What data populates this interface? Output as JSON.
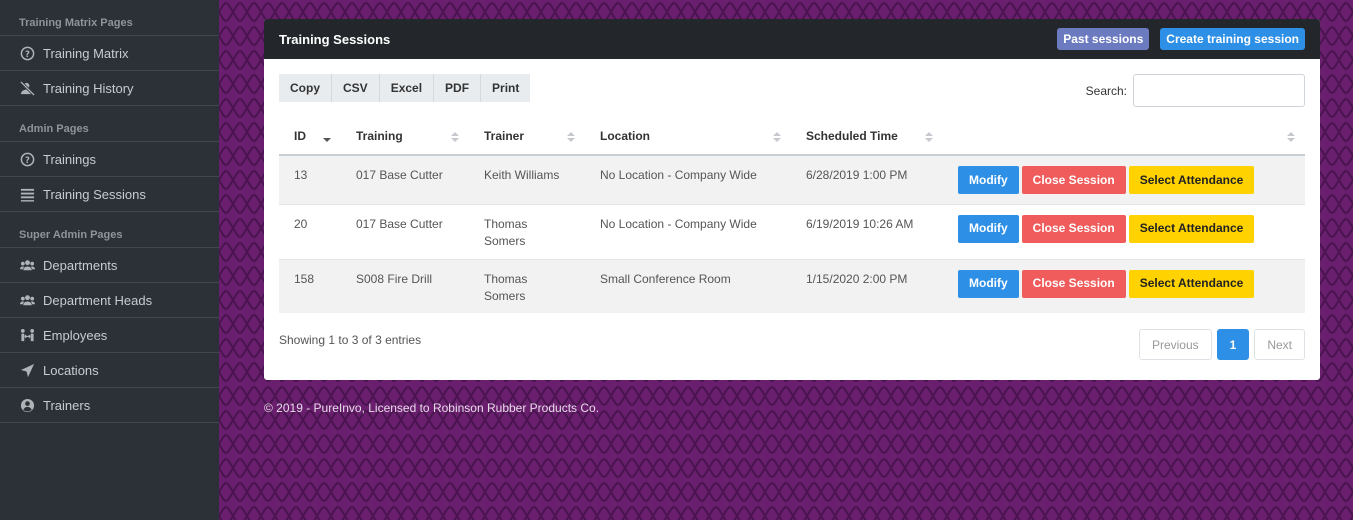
{
  "sidebar": {
    "sections": [
      {
        "title": "Training Matrix Pages",
        "items": [
          {
            "label": "Training Matrix",
            "icon": "question-circle-icon"
          },
          {
            "label": "Training History",
            "icon": "user-slash-icon"
          }
        ]
      },
      {
        "title": "Admin Pages",
        "items": [
          {
            "label": "Trainings",
            "icon": "question-circle-icon"
          },
          {
            "label": "Training Sessions",
            "icon": "list-icon"
          }
        ]
      },
      {
        "title": "Super Admin Pages",
        "items": [
          {
            "label": "Departments",
            "icon": "users-icon"
          },
          {
            "label": "Department Heads",
            "icon": "users-icon"
          },
          {
            "label": "Employees",
            "icon": "people-arrows-icon"
          },
          {
            "label": "Locations",
            "icon": "location-arrow-icon"
          },
          {
            "label": "Trainers",
            "icon": "user-circle-icon"
          }
        ]
      }
    ]
  },
  "card": {
    "title": "Training Sessions",
    "past_sessions_label": "Past sessions",
    "create_session_label": "Create training session"
  },
  "toolbar": {
    "copy": "Copy",
    "csv": "CSV",
    "excel": "Excel",
    "pdf": "PDF",
    "print": "Print"
  },
  "search": {
    "label": "Search:",
    "value": ""
  },
  "table": {
    "headers": [
      "ID",
      "Training",
      "Trainer",
      "Location",
      "Scheduled Time",
      ""
    ],
    "rows": [
      {
        "id": "13",
        "training": "017 Base Cutter",
        "trainer": "Keith Williams",
        "location": "No Location - Company Wide",
        "time": "6/28/2019 1:00 PM"
      },
      {
        "id": "20",
        "training": "017 Base Cutter",
        "trainer": "Thomas Somers",
        "location": "No Location - Company Wide",
        "time": "6/19/2019 10:26 AM"
      },
      {
        "id": "158",
        "training": "S008 Fire Drill",
        "trainer": "Thomas Somers",
        "location": "Small Conference Room",
        "time": "1/15/2020 2:00 PM"
      }
    ],
    "actions": {
      "modify": "Modify",
      "close": "Close Session",
      "attendance": "Select Attendance"
    }
  },
  "info": "Showing 1 to 3 of 3 entries",
  "pager": {
    "previous": "Previous",
    "current": "1",
    "next": "Next"
  },
  "footer": "© 2019 - PureInvo, Licensed to Robinson Rubber Products Co.",
  "colors": {
    "sidebar_bg": "#2c3138",
    "main_bg": "#6a1f6e",
    "header_bg": "#23272b",
    "primary": "#2e8fe6",
    "danger": "#f05b5b",
    "warning": "#ffd200",
    "past_btn": "#6c7bc0"
  }
}
